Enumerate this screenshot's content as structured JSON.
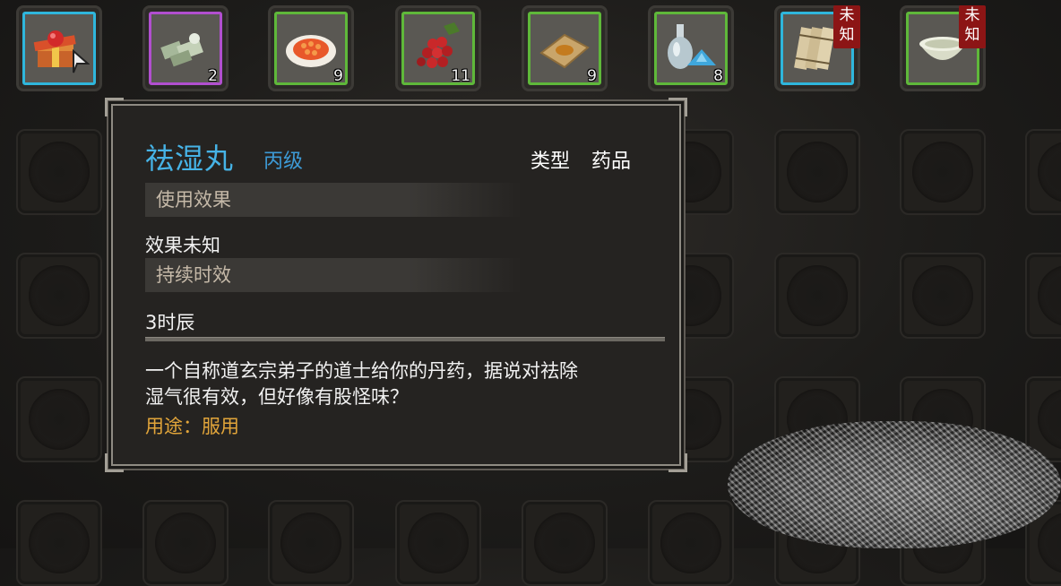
{
  "inventory": {
    "items": [
      {
        "name": "red-gift-box",
        "rarity": "cyan",
        "count": "",
        "unknown": false
      },
      {
        "name": "silver-ingots",
        "rarity": "purple",
        "count": "2",
        "unknown": false
      },
      {
        "name": "pill-plate",
        "rarity": "green",
        "count": "9",
        "unknown": false
      },
      {
        "name": "red-berries",
        "rarity": "green",
        "count": "11",
        "unknown": false
      },
      {
        "name": "herb-powder-paper",
        "rarity": "green",
        "count": "9",
        "unknown": false
      },
      {
        "name": "medicine-bottle",
        "rarity": "green",
        "count": "8",
        "unknown": false
      },
      {
        "name": "bamboo-scroll",
        "rarity": "cyan",
        "count": "",
        "unknown": true
      },
      {
        "name": "porcelain-bowl",
        "rarity": "green",
        "count": "",
        "unknown": true
      }
    ],
    "unknown_badge": [
      "未",
      "知"
    ]
  },
  "tooltip": {
    "item_name": "祛湿丸",
    "grade": "丙级",
    "type_label": "类型",
    "type_value": "药品",
    "effect_header": "使用效果",
    "effect_value": "效果未知",
    "duration_header": "持续时效",
    "duration_value": "3时辰",
    "description_line1": "一个自称道玄宗弟子的道士给你的丹药，据说对祛除",
    "description_line2": "湿气很有效，但好像有股怪味？",
    "usage": "用途：服用"
  },
  "colors": {
    "name": "#46b3e6",
    "grade": "#3d9ad6",
    "usage": "#e2a53a",
    "rarity_cyan": "#2fb6dc",
    "rarity_purple": "#b14fcf",
    "rarity_green": "#5fb83a",
    "unknown_badge": "#8c1515"
  }
}
